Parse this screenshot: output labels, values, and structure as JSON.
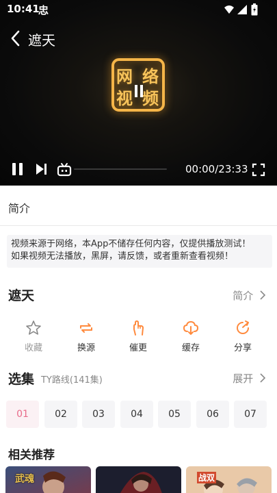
{
  "status_bar": {
    "time": "10:41",
    "bug_glyph": "忠",
    "icons": [
      "wifi-icon",
      "signal-icon",
      "battery-icon"
    ]
  },
  "player": {
    "title": "遮天",
    "logo_chars": [
      "网",
      "络",
      "视",
      "频"
    ],
    "current_time": "00:00",
    "duration": "23:33",
    "time_display": "00:00/23:33",
    "progress": 0.0,
    "controls": [
      "back-icon",
      "pause-icon",
      "next-icon",
      "danmaku-icon",
      "fullscreen-icon"
    ]
  },
  "intro_tab": {
    "label": "简介"
  },
  "notice": {
    "line1": "视频来源于网络，本App不储存任何内容，仅提供播放测试！",
    "line2": "如果视频无法播放，黑屏，请反馈，或者重新查看视频！"
  },
  "show": {
    "title": "遮天",
    "intro_link": "简介"
  },
  "actions": [
    {
      "label": "收藏",
      "icon": "star-icon",
      "enabled": false
    },
    {
      "label": "换源",
      "icon": "swap-icon",
      "enabled": true
    },
    {
      "label": "催更",
      "icon": "hand-icon",
      "enabled": true
    },
    {
      "label": "缓存",
      "icon": "download-cloud-icon",
      "enabled": true
    },
    {
      "label": "分享",
      "icon": "share-icon",
      "enabled": true
    }
  ],
  "episodes_section": {
    "title": "选集",
    "route_label": "TY路线(141集)",
    "expand_label": "展开",
    "episodes": [
      "01",
      "02",
      "03",
      "04",
      "05",
      "06",
      "07"
    ],
    "active_index": 0
  },
  "related": {
    "title": "相关推荐",
    "thumb_texts": [
      "武魂",
      "战双"
    ]
  },
  "colors": {
    "accent": "#ff8a3d",
    "active_episode": "#e86b8a",
    "disabled": "#999999"
  }
}
